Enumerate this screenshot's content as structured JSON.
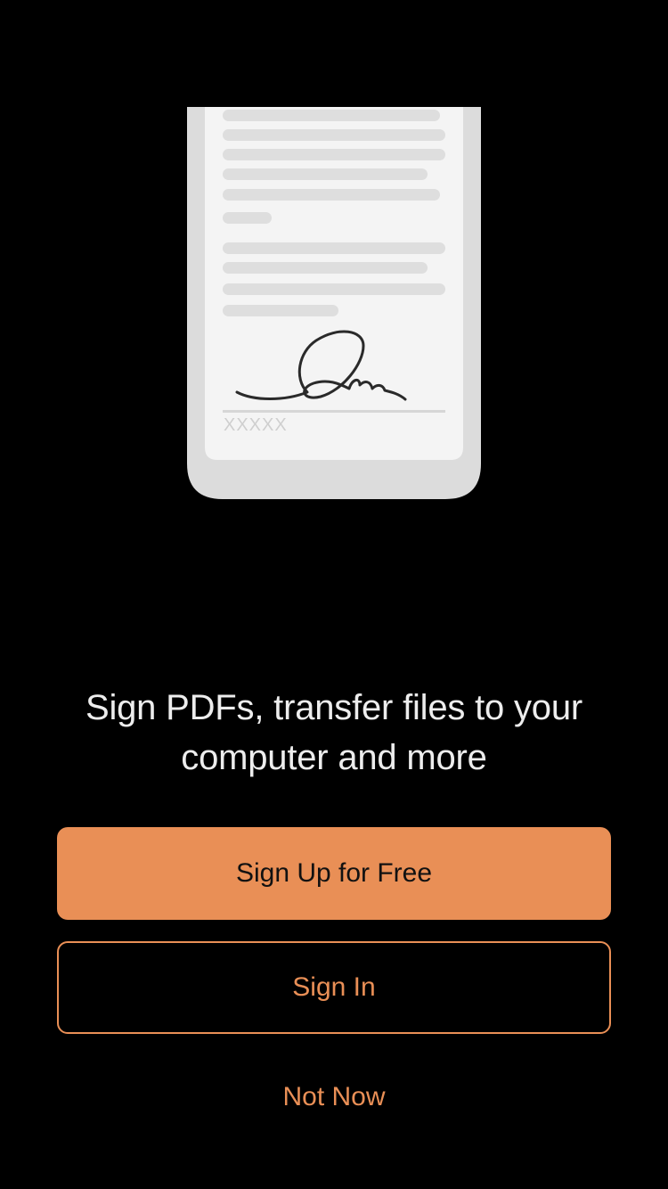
{
  "illustration": {
    "placeholder_mark": "XXXXX",
    "colors": {
      "frame": "#dcdcdc",
      "paper": "#f4f4f4",
      "line": "#dedede",
      "ink": "#2a2a2a",
      "mark": "#cfcfcf"
    }
  },
  "headline": "Sign PDFs, transfer files to your computer and more",
  "buttons": {
    "sign_up": "Sign Up for Free",
    "sign_in": "Sign In",
    "not_now": "Not Now"
  },
  "colors": {
    "background": "#000000",
    "accent": "#e98f56",
    "headline_text": "#ededed"
  }
}
